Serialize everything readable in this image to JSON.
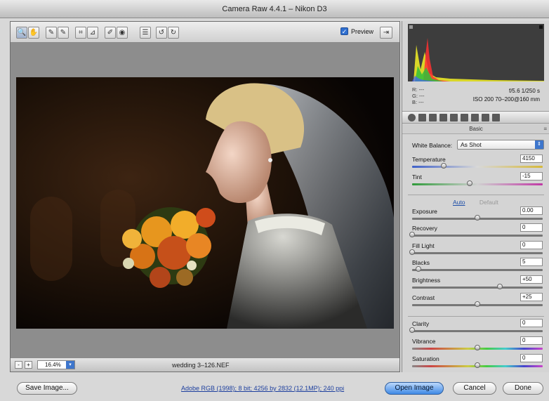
{
  "window": {
    "title": "Camera Raw 4.4.1  –  Nikon D3"
  },
  "toolbar": {
    "tools": [
      {
        "name": "zoom-tool",
        "glyph": "🔍"
      },
      {
        "name": "hand-tool",
        "glyph": "✋"
      },
      {
        "name": "white-balance-tool",
        "glyph": "✎"
      },
      {
        "name": "color-sampler-tool",
        "glyph": "✎"
      },
      {
        "name": "crop-tool",
        "glyph": "⌗"
      },
      {
        "name": "straighten-tool",
        "glyph": "⊿"
      },
      {
        "name": "retouch-tool",
        "glyph": "✐"
      },
      {
        "name": "red-eye-tool",
        "glyph": "◉"
      },
      {
        "name": "preferences-button",
        "glyph": "☰"
      },
      {
        "name": "rotate-ccw-button",
        "glyph": "↺"
      },
      {
        "name": "rotate-cw-button",
        "glyph": "↻"
      }
    ],
    "preview_label": "Preview",
    "preview_checked": "✓",
    "fullscreen_glyph": "⇥"
  },
  "image": {
    "filename": "wedding 3–126.NEF"
  },
  "zoom": {
    "level": "16.4%",
    "minus": "-",
    "plus": "+"
  },
  "info": {
    "r": "R:  ---",
    "g": "G:  ---",
    "b": "B:  ---",
    "aperture_shutter": "f/5.6   1/250 s",
    "iso_lens": "ISO 200   70–200@160 mm"
  },
  "panel": {
    "title": "Basic",
    "menu_glyph": "≡",
    "white_balance_label": "White Balance:",
    "white_balance_value": "As Shot",
    "auto_label": "Auto",
    "default_label": "Default",
    "adjustments": [
      {
        "label": "Temperature",
        "value": "4150",
        "pos": 0.24
      },
      {
        "label": "Tint",
        "value": "-15",
        "pos": 0.44
      },
      {
        "label": "Exposure",
        "value": "0.00",
        "pos": 0.5
      },
      {
        "label": "Recovery",
        "value": "0",
        "pos": 0.0
      },
      {
        "label": "Fill Light",
        "value": "0",
        "pos": 0.0
      },
      {
        "label": "Blacks",
        "value": "5",
        "pos": 0.05
      },
      {
        "label": "Brightness",
        "value": "+50",
        "pos": 0.67
      },
      {
        "label": "Contrast",
        "value": "+25",
        "pos": 0.5
      },
      {
        "label": "Clarity",
        "value": "0",
        "pos": 0.0
      },
      {
        "label": "Vibrance",
        "value": "0",
        "pos": 0.5
      },
      {
        "label": "Saturation",
        "value": "0",
        "pos": 0.5
      }
    ]
  },
  "footer": {
    "save_label": "Save Image...",
    "workflow_link": "Adobe RGB (1998); 8 bit; 4256 by 2832 (12.1MP); 240 ppi",
    "open_label": "Open Image",
    "cancel_label": "Cancel",
    "done_label": "Done"
  }
}
